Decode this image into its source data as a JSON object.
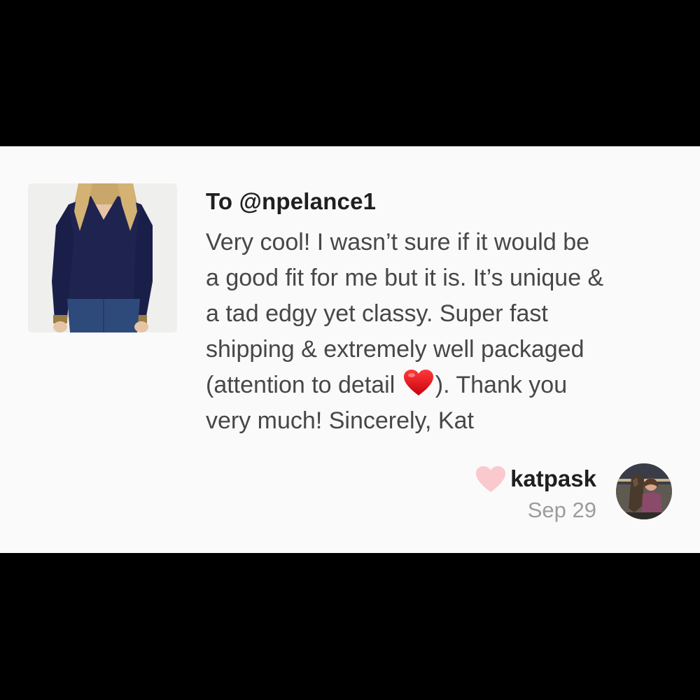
{
  "comment": {
    "recipient": "To @npelance1",
    "message_lines": [
      "Very cool! I wasn’t sure if it would be",
      "a good fit for me but it is. It’s unique &",
      "a tad edgy yet classy. Super fast",
      "shipping & extremely well packaged",
      "(attention to detail",
      "). Thank you",
      "very much! Sincerely, Kat"
    ],
    "inline_emoji": "red-heart-emoji",
    "author": "katpask",
    "date": "Sep 29",
    "like_icon": "heart-icon"
  },
  "colors": {
    "background_bars": "#000000",
    "card_background": "#fbfafa",
    "primary_text": "#1f1f1f",
    "body_text": "#474747",
    "muted_text": "#9c9c9c",
    "like_heart": "#f9c9cd",
    "emoji_heart": "#e0121c"
  }
}
